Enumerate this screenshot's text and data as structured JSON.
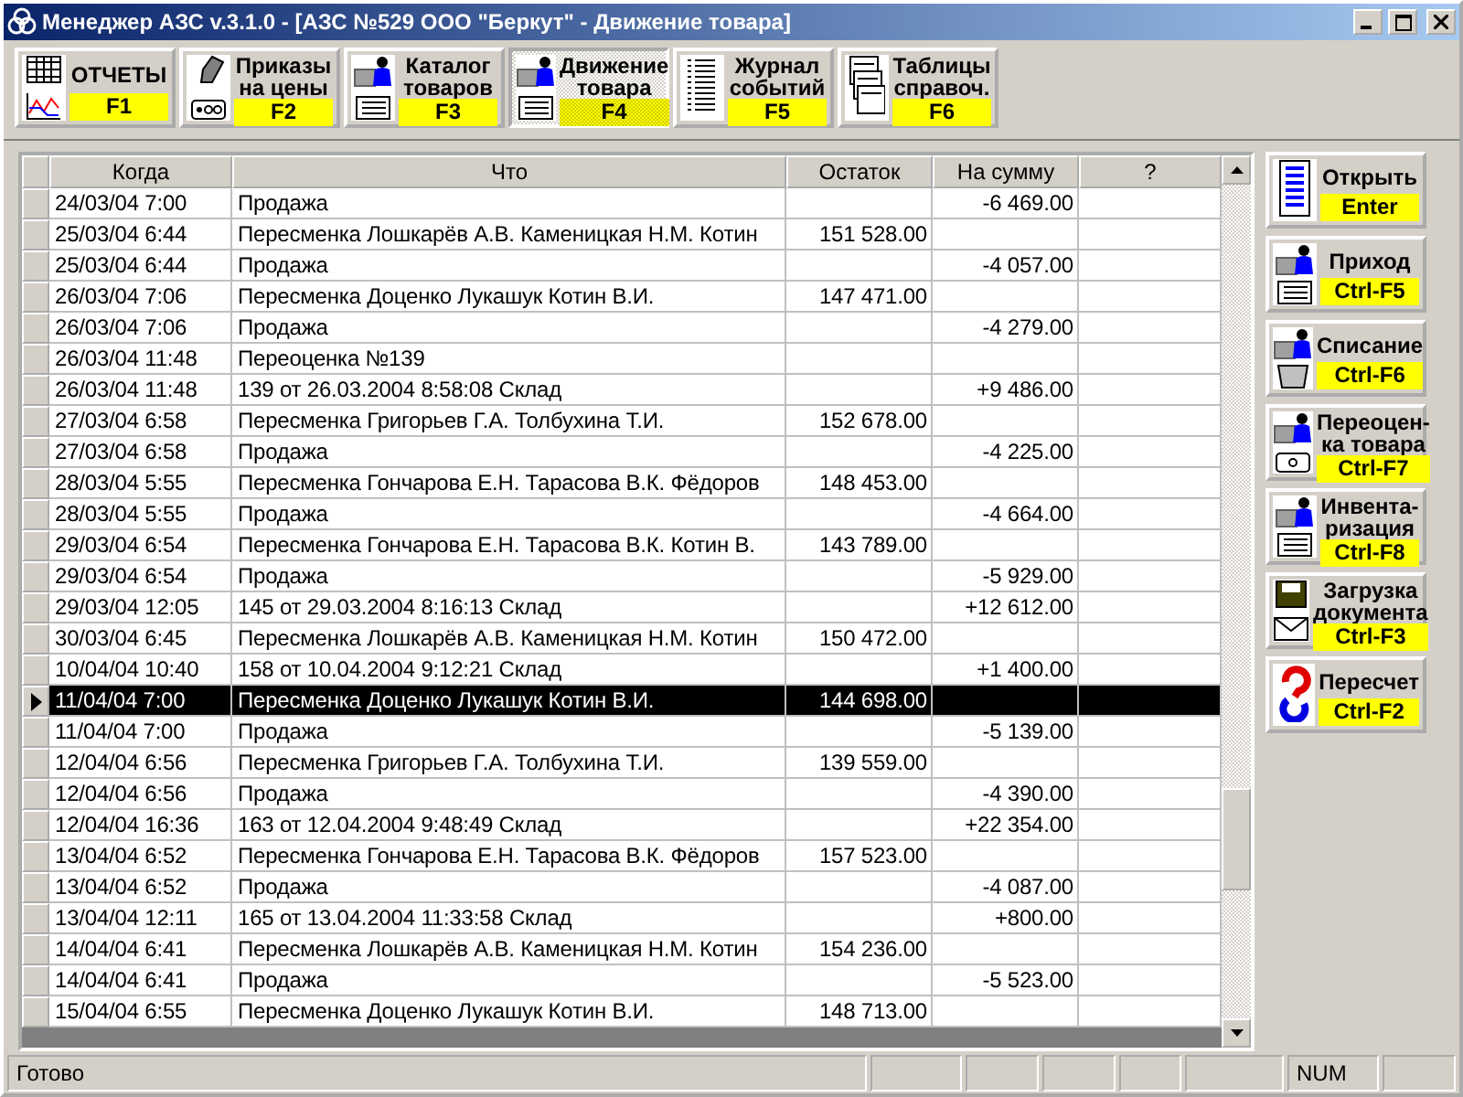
{
  "window": {
    "title": "Менеджер АЗС v.3.1.0 - [АЗС №529 ООО \"Беркут\" - Движение товара]"
  },
  "toolbar": [
    {
      "label": "ОТЧЕТЫ",
      "key": "F1",
      "selected": false
    },
    {
      "label": "Приказы\nна цены",
      "key": "F2",
      "selected": false
    },
    {
      "label": "Каталог\nтоваров",
      "key": "F3",
      "selected": false
    },
    {
      "label": "Движение\nтовара",
      "key": "F4",
      "selected": true
    },
    {
      "label": "Журнал\nсобытий",
      "key": "F5",
      "selected": false
    },
    {
      "label": "Таблицы\nсправоч.",
      "key": "F6",
      "selected": false
    }
  ],
  "table": {
    "columns": [
      "Когда",
      "Что",
      "Остаток",
      "На сумму",
      "?"
    ],
    "rows": [
      {
        "when": "24/03/04 7:00",
        "what": "Продажа",
        "balance": "",
        "amount": "-6 469.00",
        "selected": false
      },
      {
        "when": "25/03/04 6:44",
        "what": "Пересменка Лошкарёв А.В. Каменицкая Н.М. Котин",
        "balance": "151 528.00",
        "amount": "",
        "selected": false
      },
      {
        "when": "25/03/04 6:44",
        "what": "Продажа",
        "balance": "",
        "amount": "-4 057.00",
        "selected": false
      },
      {
        "when": "26/03/04 7:06",
        "what": "Пересменка Доценко Лукашук Котин В.И.",
        "balance": "147 471.00",
        "amount": "",
        "selected": false
      },
      {
        "when": "26/03/04 7:06",
        "what": "Продажа",
        "balance": "",
        "amount": "-4 279.00",
        "selected": false
      },
      {
        "when": "26/03/04 11:48",
        "what": "Переоценка №139",
        "balance": "",
        "amount": "",
        "selected": false
      },
      {
        "when": "26/03/04 11:48",
        "what": "139 от 26.03.2004 8:58:08 Склад",
        "balance": "",
        "amount": "+9 486.00",
        "selected": false
      },
      {
        "when": "27/03/04 6:58",
        "what": "Пересменка Григорьев Г.А. Толбухина Т.И.",
        "balance": "152 678.00",
        "amount": "",
        "selected": false
      },
      {
        "when": "27/03/04 6:58",
        "what": "Продажа",
        "balance": "",
        "amount": "-4 225.00",
        "selected": false
      },
      {
        "when": "28/03/04 5:55",
        "what": "Пересменка Гончарова Е.Н. Тарасова В.К. Фёдоров",
        "balance": "148 453.00",
        "amount": "",
        "selected": false
      },
      {
        "when": "28/03/04 5:55",
        "what": "Продажа",
        "balance": "",
        "amount": "-4 664.00",
        "selected": false
      },
      {
        "when": "29/03/04 6:54",
        "what": "Пересменка Гончарова Е.Н. Тарасова В.К. Котин В.",
        "balance": "143 789.00",
        "amount": "",
        "selected": false
      },
      {
        "when": "29/03/04 6:54",
        "what": "Продажа",
        "balance": "",
        "amount": "-5 929.00",
        "selected": false
      },
      {
        "when": "29/03/04 12:05",
        "what": "145 от 29.03.2004 8:16:13 Склад",
        "balance": "",
        "amount": "+12 612.00",
        "selected": false
      },
      {
        "when": "30/03/04 6:45",
        "what": "Пересменка Лошкарёв А.В. Каменицкая Н.М. Котин",
        "balance": "150 472.00",
        "amount": "",
        "selected": false
      },
      {
        "when": "10/04/04 10:40",
        "what": "158 от 10.04.2004 9:12:21 Склад",
        "balance": "",
        "amount": "+1 400.00",
        "selected": false
      },
      {
        "when": "11/04/04 7:00",
        "what": "Пересменка Доценко Лукашук Котин В.И.",
        "balance": "144 698.00",
        "amount": "",
        "selected": true
      },
      {
        "when": "11/04/04 7:00",
        "what": "Продажа",
        "balance": "",
        "amount": "-5 139.00",
        "selected": false
      },
      {
        "when": "12/04/04 6:56",
        "what": "Пересменка Григорьев Г.А. Толбухина Т.И.",
        "balance": "139 559.00",
        "amount": "",
        "selected": false
      },
      {
        "when": "12/04/04 6:56",
        "what": "Продажа",
        "balance": "",
        "amount": "-4 390.00",
        "selected": false
      },
      {
        "when": "12/04/04 16:36",
        "what": "163 от 12.04.2004 9:48:49 Склад",
        "balance": "",
        "amount": "+22 354.00",
        "selected": false
      },
      {
        "when": "13/04/04 6:52",
        "what": "Пересменка Гончарова Е.Н. Тарасова В.К. Фёдоров",
        "balance": "157 523.00",
        "amount": "",
        "selected": false
      },
      {
        "when": "13/04/04 6:52",
        "what": "Продажа",
        "balance": "",
        "amount": "-4 087.00",
        "selected": false
      },
      {
        "when": "13/04/04 12:11",
        "what": "165 от 13.04.2004 11:33:58 Склад",
        "balance": "",
        "amount": "+800.00",
        "selected": false
      },
      {
        "when": "14/04/04 6:41",
        "what": "Пересменка Лошкарёв А.В. Каменицкая Н.М. Котин",
        "balance": "154 236.00",
        "amount": "",
        "selected": false
      },
      {
        "when": "14/04/04 6:41",
        "what": "Продажа",
        "balance": "",
        "amount": "-5 523.00",
        "selected": false
      },
      {
        "when": "15/04/04 6:55",
        "what": "Пересменка Доценко Лукашук Котин В.И.",
        "balance": "148 713.00",
        "amount": "",
        "selected": false
      }
    ]
  },
  "actions": [
    {
      "label": "Открыть",
      "key": "Enter"
    },
    {
      "label": "Приход",
      "key": "Ctrl-F5"
    },
    {
      "label": "Списание",
      "key": "Ctrl-F6"
    },
    {
      "label": "Переоцен-\nка товара",
      "key": "Ctrl-F7"
    },
    {
      "label": "Инвента-\nризация",
      "key": "Ctrl-F8"
    },
    {
      "label": "Загрузка\nдокумента",
      "key": "Ctrl-F3"
    },
    {
      "label": "Пересчет",
      "key": "Ctrl-F2"
    }
  ],
  "status_bar": {
    "text": "Готово",
    "indicator": "NUM"
  }
}
